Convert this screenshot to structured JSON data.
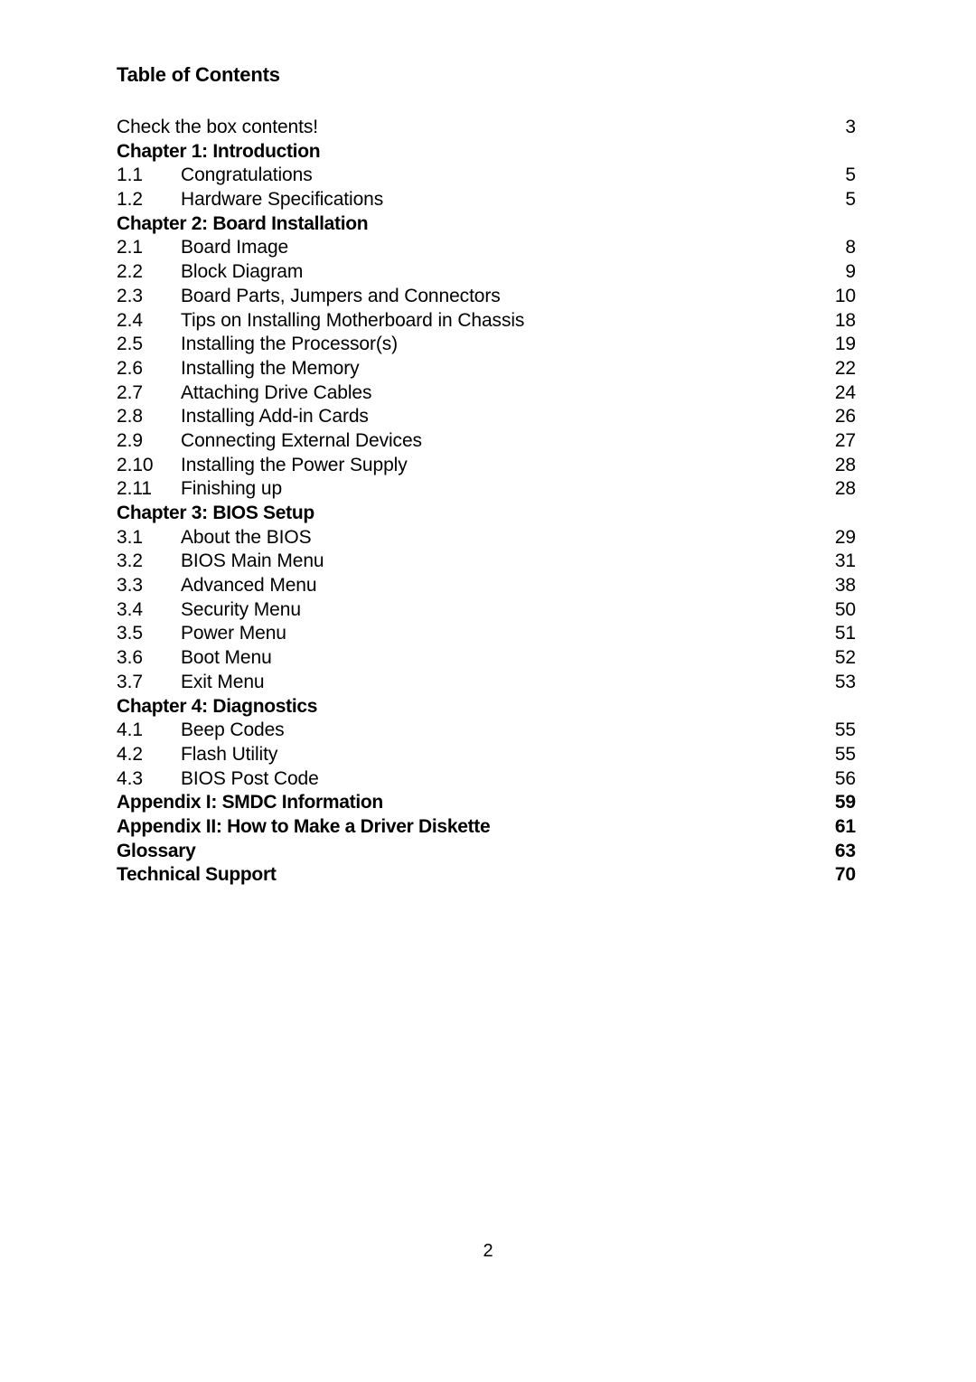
{
  "document": {
    "title": "Table of Contents",
    "footer_page_number": "2"
  },
  "toc": {
    "entries": [
      {
        "number": "",
        "label": "Check the box contents!",
        "page": "3",
        "style": "plain"
      },
      {
        "number": "",
        "label": "Chapter 1: Introduction",
        "page": "",
        "style": "heading"
      },
      {
        "number": "1.1",
        "label": "Congratulations",
        "page": "5",
        "style": "entry"
      },
      {
        "number": "1.2",
        "label": "Hardware Specifications",
        "page": "5",
        "style": "entry"
      },
      {
        "number": "",
        "label": "Chapter 2: Board Installation",
        "page": "",
        "style": "heading"
      },
      {
        "number": "2.1",
        "label": "Board Image",
        "page": "8",
        "style": "entry"
      },
      {
        "number": "2.2",
        "label": "Block Diagram",
        "page": "9",
        "style": "entry"
      },
      {
        "number": "2.3",
        "label": "Board Parts, Jumpers and Connectors",
        "page": "10",
        "style": "entry"
      },
      {
        "number": "2.4",
        "label": "Tips on Installing Motherboard in Chassis",
        "page": "18",
        "style": "entry"
      },
      {
        "number": "2.5",
        "label": "Installing the Processor(s)",
        "page": "19",
        "style": "entry"
      },
      {
        "number": "2.6",
        "label": "Installing the Memory",
        "page": "22",
        "style": "entry"
      },
      {
        "number": "2.7",
        "label": "Attaching Drive Cables",
        "page": "24",
        "style": "entry"
      },
      {
        "number": "2.8",
        "label": "Installing Add-in Cards",
        "page": "26",
        "style": "entry"
      },
      {
        "number": "2.9",
        "label": "Connecting External Devices",
        "page": "27",
        "style": "entry"
      },
      {
        "number": "2.10",
        "label": "Installing the Power Supply",
        "page": "28",
        "style": "entry"
      },
      {
        "number": "2.11",
        "label": "Finishing up",
        "page": "28",
        "style": "entry"
      },
      {
        "number": "",
        "label": "Chapter 3: BIOS Setup",
        "page": "",
        "style": "heading"
      },
      {
        "number": "3.1",
        "label": "About the BIOS",
        "page": "29",
        "style": "entry"
      },
      {
        "number": "3.2",
        "label": "BIOS Main Menu",
        "page": "31",
        "style": "entry"
      },
      {
        "number": "3.3",
        "label": "Advanced Menu",
        "page": "38",
        "style": "entry"
      },
      {
        "number": "3.4",
        "label": "Security Menu",
        "page": "50",
        "style": "entry"
      },
      {
        "number": "3.5",
        "label": "Power Menu",
        "page": "51",
        "style": "entry"
      },
      {
        "number": "3.6",
        "label": "Boot Menu",
        "page": "52",
        "style": "entry"
      },
      {
        "number": "3.7",
        "label": "Exit Menu",
        "page": "53",
        "style": "entry"
      },
      {
        "number": "",
        "label": "Chapter 4: Diagnostics",
        "page": "",
        "style": "heading"
      },
      {
        "number": "4.1",
        "label": "Beep Codes",
        "page": "55",
        "style": "entry"
      },
      {
        "number": "4.2",
        "label": "Flash Utility",
        "page": "55",
        "style": "entry"
      },
      {
        "number": "4.3",
        "label": "BIOS Post Code",
        "page": "56",
        "style": "entry"
      },
      {
        "number": "",
        "label": "Appendix I: SMDC Information",
        "page": "59",
        "style": "heading"
      },
      {
        "number": "",
        "label": "Appendix II: How to Make a Driver Diskette",
        "page": "61",
        "style": "heading"
      },
      {
        "number": "",
        "label": "Glossary",
        "page": "63",
        "style": "heading"
      },
      {
        "number": "",
        "label": "Technical Support",
        "page": "70",
        "style": "heading"
      }
    ]
  }
}
